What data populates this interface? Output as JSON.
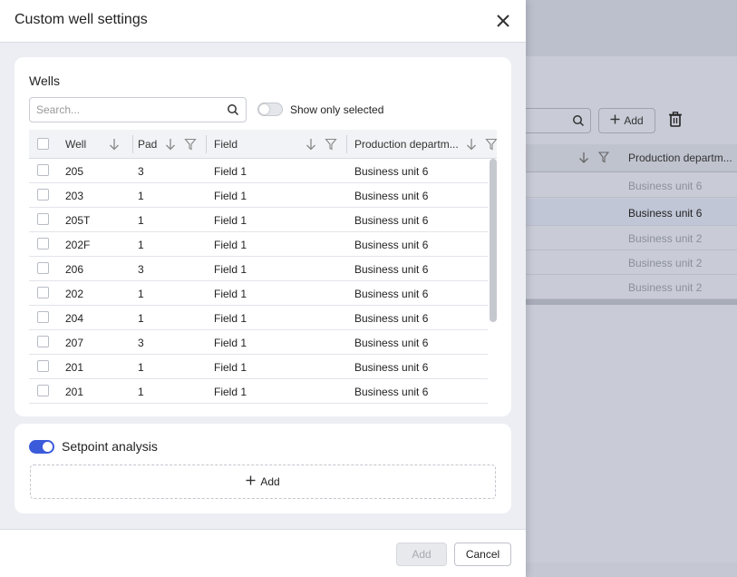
{
  "dialog": {
    "title": "Custom well settings",
    "wells": {
      "title": "Wells",
      "search_placeholder": "Search...",
      "show_only_selected_label": "Show only selected",
      "show_only_selected": false,
      "columns": {
        "well": "Well",
        "pad": "Pad",
        "field": "Field",
        "production_department": "Production departm..."
      },
      "rows": [
        {
          "well": "205",
          "pad": "3",
          "field": "Field 1",
          "dept": "Business unit 6"
        },
        {
          "well": "203",
          "pad": "1",
          "field": "Field 1",
          "dept": "Business unit 6"
        },
        {
          "well": "205T",
          "pad": "1",
          "field": "Field 1",
          "dept": "Business unit 6"
        },
        {
          "well": "202F",
          "pad": "1",
          "field": "Field 1",
          "dept": "Business unit 6"
        },
        {
          "well": "206",
          "pad": "3",
          "field": "Field 1",
          "dept": "Business unit 6"
        },
        {
          "well": "202",
          "pad": "1",
          "field": "Field 1",
          "dept": "Business unit 6"
        },
        {
          "well": "204",
          "pad": "1",
          "field": "Field 1",
          "dept": "Business unit 6"
        },
        {
          "well": "207",
          "pad": "3",
          "field": "Field 1",
          "dept": "Business unit 6"
        },
        {
          "well": "201",
          "pad": "1",
          "field": "Field 1",
          "dept": "Business unit 6"
        },
        {
          "well": "201",
          "pad": "1",
          "field": "Field 1",
          "dept": "Business unit 6"
        }
      ]
    },
    "setpoint": {
      "label": "Setpoint analysis",
      "enabled": true,
      "add_label": "Add"
    },
    "footer": {
      "add_label": "Add",
      "cancel_label": "Cancel"
    }
  },
  "background": {
    "add_label": "Add",
    "column_header": "Production departm...",
    "rows": [
      {
        "dept": "Business unit 6",
        "selected": false
      },
      {
        "dept": "Business unit 6",
        "selected": true
      },
      {
        "dept": "Business unit 2",
        "selected": false
      },
      {
        "dept": "Business unit 2",
        "selected": false
      },
      {
        "dept": "Business unit 2",
        "selected": false
      }
    ]
  },
  "colors": {
    "accent": "#3b5bdb",
    "overlay": "#c5c8d3"
  }
}
